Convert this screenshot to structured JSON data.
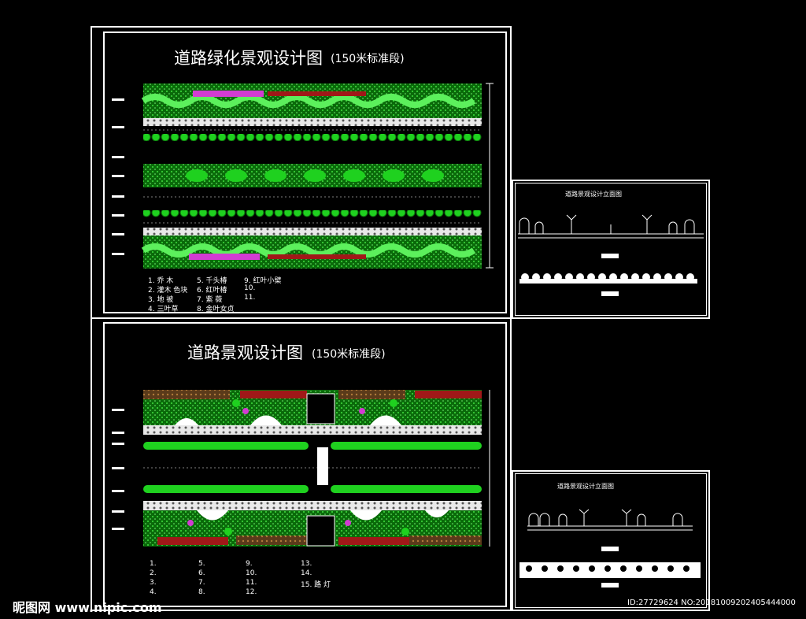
{
  "top_plan": {
    "title": "道路绿化景观设计图",
    "subtitle": "(150米标准段)",
    "legend": [
      "1. 乔  木",
      "2. 灌木 色块",
      "3. 地  被",
      "4. 三叶草",
      "5. 千头椿",
      "6. 红叶椿",
      "7. 紫  薇",
      "8. 金叶女贞",
      "9. 红叶小檗",
      "10.",
      "11."
    ]
  },
  "bottom_plan": {
    "title": "道路景观设计图",
    "subtitle": "(150米标准段)",
    "legend": [
      "1.",
      "2.",
      "3.",
      "4.",
      "5.",
      "6.",
      "7.",
      "8.",
      "9.",
      "10.",
      "11.",
      "12.",
      "13.",
      "14.",
      "15. 路  灯"
    ]
  },
  "section_top": {
    "title": "道路景观设计立面图"
  },
  "section_bottom": {
    "title": "道路景观设计立面图"
  },
  "watermark": {
    "left": "昵图网 www.nipic.com",
    "right": "ID:27729624 NO:20181009202405444000"
  },
  "colors": {
    "green": "#1fd11f",
    "light_green": "#5cf05c",
    "magenta": "#d23cd2",
    "dark_red": "#a01818",
    "brown": "#8a5a2a"
  }
}
